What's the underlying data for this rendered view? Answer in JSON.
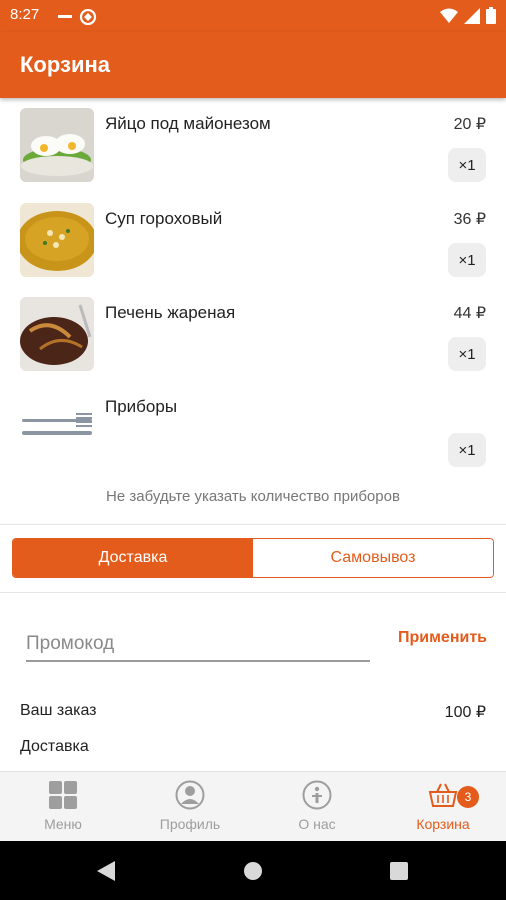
{
  "status_bar": {
    "time": "8:27"
  },
  "app_bar": {
    "title": "Корзина"
  },
  "cart": {
    "items": [
      {
        "name": "Яйцо под майонезом",
        "price": "20 ₽",
        "qty": "×1",
        "image": "egg-mayo-photo"
      },
      {
        "name": "Суп гороховый",
        "price": "36 ₽",
        "qty": "×1",
        "image": "pea-soup-photo"
      },
      {
        "name": "Печень жареная",
        "price": "44 ₽",
        "qty": "×1",
        "image": "fried-liver-photo"
      },
      {
        "name": "Приборы",
        "price": "",
        "qty": "×1",
        "image": "cutlery-photo"
      }
    ],
    "hint": "Не забудьте указать количество приборов"
  },
  "delivery_toggle": {
    "options": [
      "Доставка",
      "Самовывоз"
    ],
    "selected": "Доставка"
  },
  "promo": {
    "placeholder": "Промокод",
    "value": "",
    "apply_label": "Применить"
  },
  "summary": {
    "order_label": "Ваш заказ",
    "order_value": "100 ₽",
    "delivery_label": "Доставка",
    "delivery_value": ""
  },
  "bottom_nav": {
    "items": [
      {
        "label": "Меню",
        "icon": "grid-icon"
      },
      {
        "label": "Профиль",
        "icon": "profile-icon"
      },
      {
        "label": "О нас",
        "icon": "info-icon"
      },
      {
        "label": "Корзина",
        "icon": "basket-icon",
        "badge": "3",
        "active": true
      }
    ]
  },
  "colors": {
    "accent": "#e35c1c",
    "inactive": "#9e9e9e"
  }
}
